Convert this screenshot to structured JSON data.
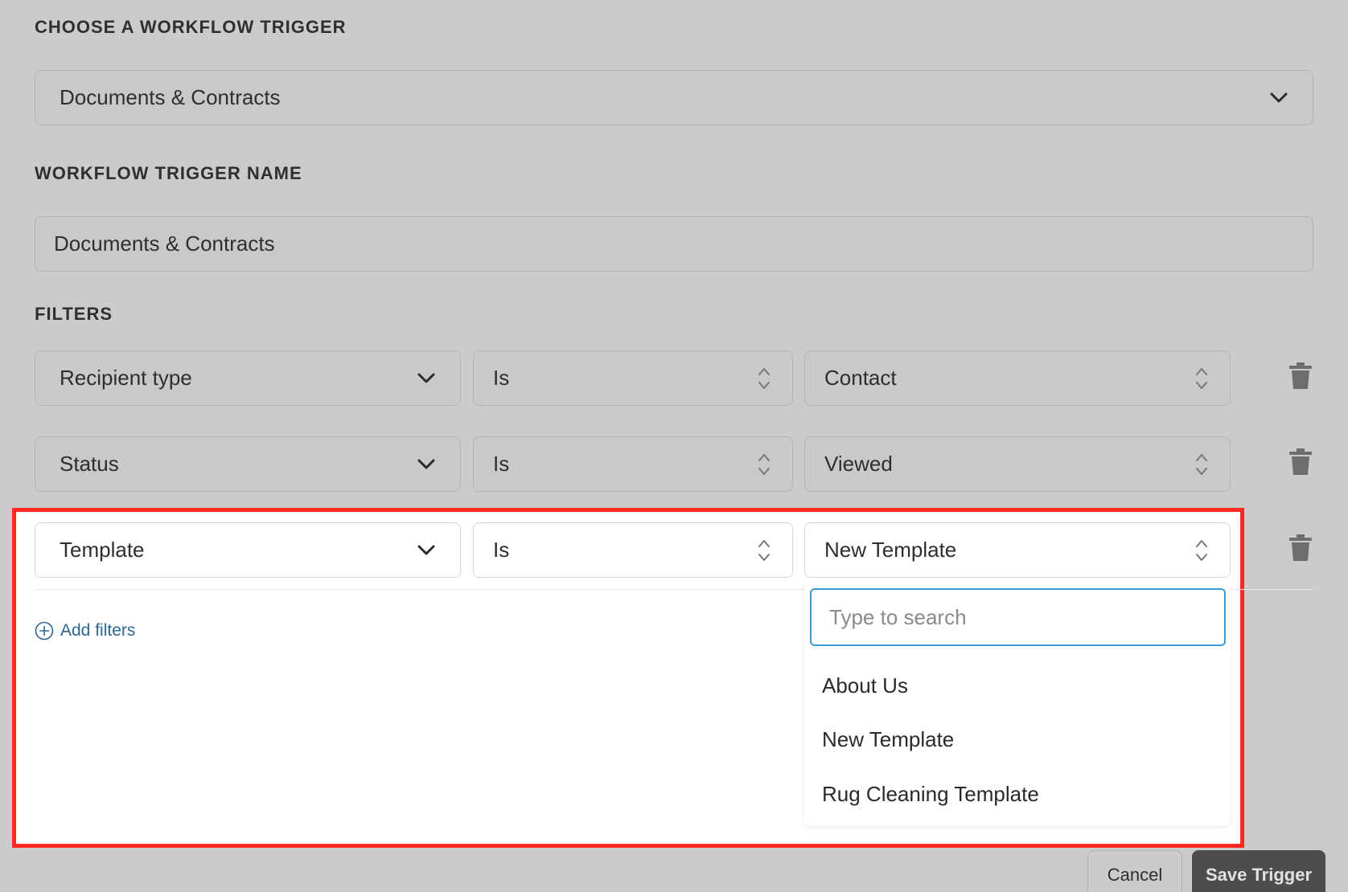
{
  "trigger": {
    "section_label": "CHOOSE A WORKFLOW TRIGGER",
    "selected": "Documents & Contracts"
  },
  "trigger_name": {
    "section_label": "WORKFLOW TRIGGER NAME",
    "value": "Documents & Contracts"
  },
  "filters": {
    "section_label": "FILTERS",
    "rows": [
      {
        "field": "Recipient type",
        "operator": "Is",
        "value": "Contact"
      },
      {
        "field": "Status",
        "operator": "Is",
        "value": "Viewed"
      },
      {
        "field": "Template",
        "operator": "Is",
        "value": "New Template"
      }
    ],
    "add_label": "Add filters"
  },
  "template_dropdown": {
    "search_placeholder": "Type to search",
    "options": [
      "About Us",
      "New Template",
      "Rug Cleaning Template"
    ]
  },
  "footer": {
    "cancel_label": "Cancel",
    "save_label": "Save Trigger"
  },
  "colors": {
    "overlay_bg": "#cbcbcb",
    "highlight_border": "#ff2a1f",
    "search_focus": "#3b9bd3",
    "link": "#2d6690",
    "save_button": "#4d4d4d"
  },
  "icons": {
    "select": "chevron-down-icon",
    "stepper": "up-down-chevron-icon",
    "delete": "trash-icon",
    "add": "plus-circle-icon"
  }
}
